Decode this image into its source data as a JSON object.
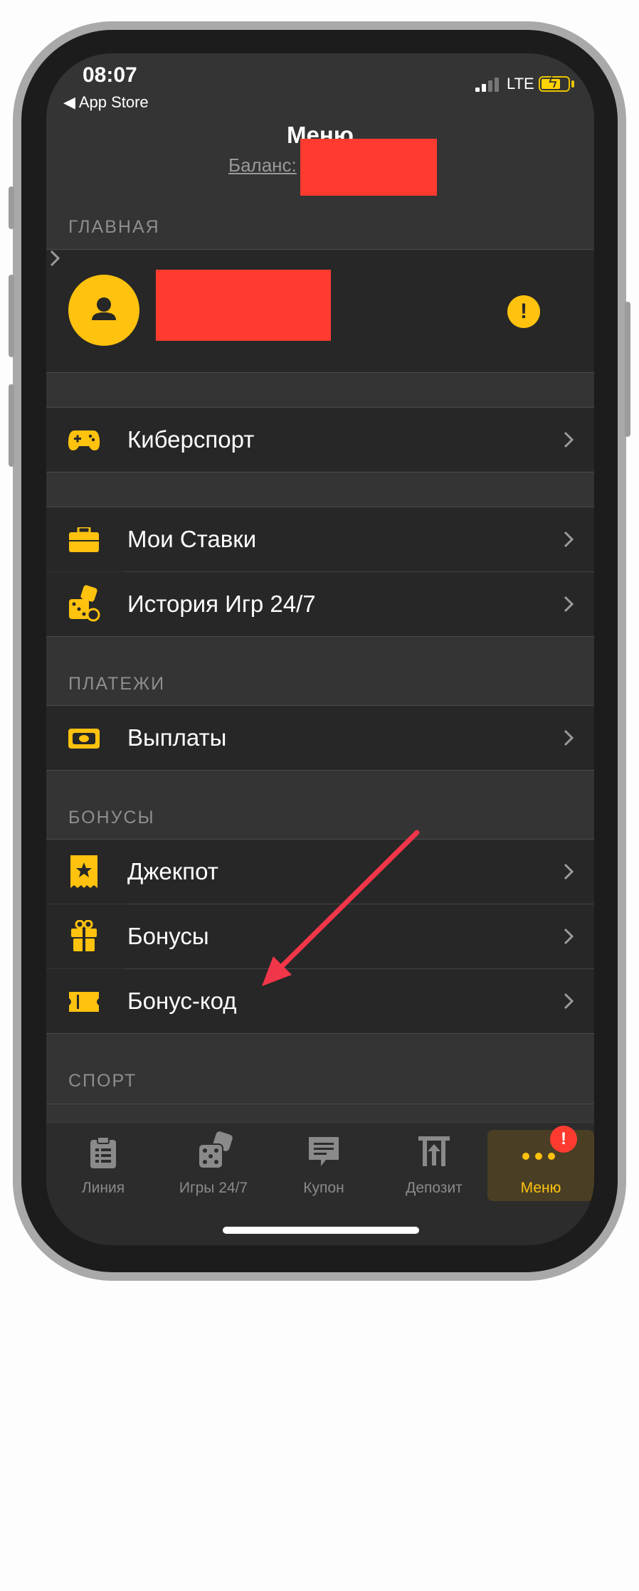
{
  "status_bar": {
    "time": "08:07",
    "back_label": "◀ App Store",
    "network": "LTE"
  },
  "header": {
    "title": "Меню",
    "balance_label": "Баланс:"
  },
  "sections": {
    "main": "ГЛАВНАЯ",
    "payments": "ПЛАТЕЖИ",
    "bonuses": "БОНУСЫ",
    "sport": "СПОРТ"
  },
  "profile": {
    "warning_symbol": "!"
  },
  "menu": {
    "esports": "Киберспорт",
    "my_bets": "Мои Ставки",
    "game_history": "История Игр 24/7",
    "payouts": "Выплаты",
    "jackpot": "Джекпот",
    "bonuses": "Бонусы",
    "bonus_code": "Бонус-код"
  },
  "tabbar": {
    "tabs": [
      {
        "label": "Линия",
        "icon": "clipboard-icon"
      },
      {
        "label": "Игры 24/7",
        "icon": "dice-icon"
      },
      {
        "label": "Купон",
        "icon": "receipt-icon"
      },
      {
        "label": "Депозит",
        "icon": "deposit-icon"
      },
      {
        "label": "Меню",
        "icon": "more-icon",
        "active": true,
        "badge": "!"
      }
    ]
  },
  "colors": {
    "accent": "#ffc20e",
    "background": "#343434",
    "row": "#272727",
    "redaction": "#ff3b30",
    "annotation_arrow": "#f2364a"
  }
}
